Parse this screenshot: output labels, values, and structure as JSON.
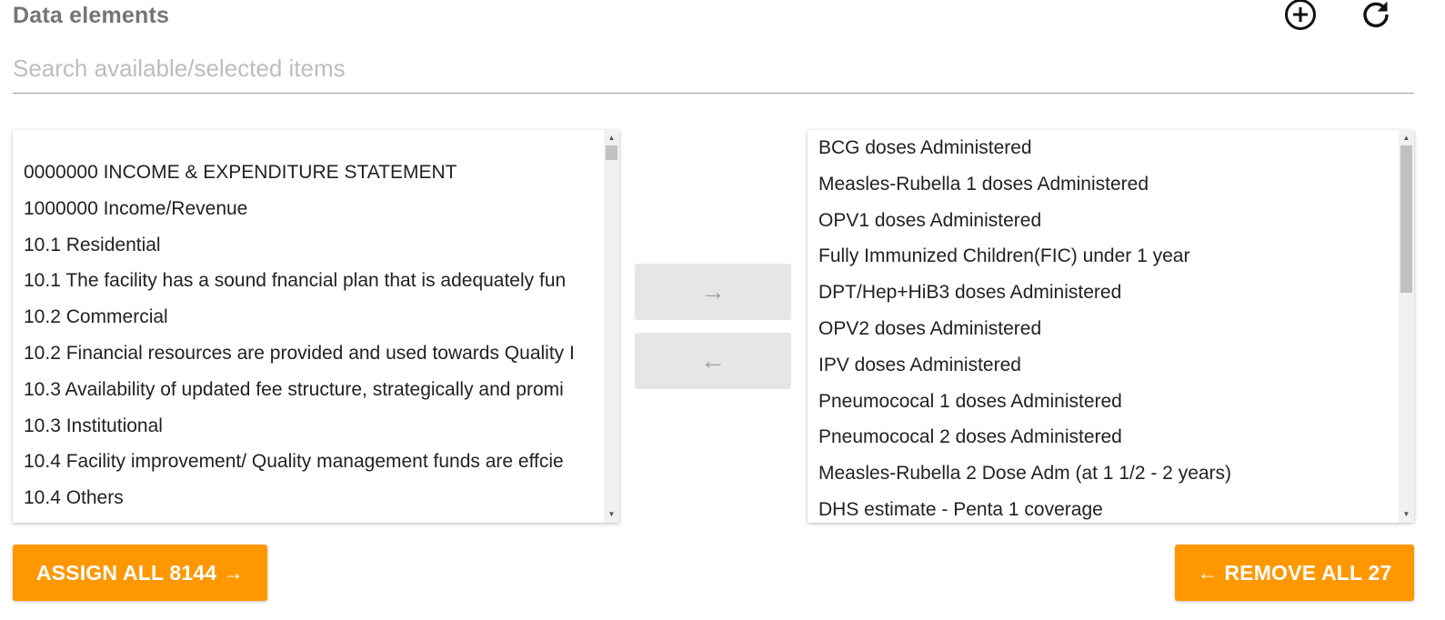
{
  "header": {
    "title": "Data elements",
    "add_icon": "add-circle-icon",
    "refresh_icon": "refresh-icon"
  },
  "search": {
    "placeholder": "Search available/selected items",
    "value": ""
  },
  "available": {
    "items": [
      "0000000 INCOME & EXPENDITURE STATEMENT",
      "1000000 Income/Revenue",
      "10.1 Residential",
      "10.1 The facility has a sound fnancial plan that is adequately fun",
      "10.2 Commercial",
      "10.2 Financial resources are provided and used towards Quality I",
      "10.3 Availability of updated fee structure, strategically and promi",
      "10.3 Institutional",
      "10.4 Facility improvement/ Quality management funds are effcie",
      "10.4 Others"
    ]
  },
  "selected": {
    "items": [
      "BCG doses Administered",
      "Measles-Rubella 1 doses Administered",
      "OPV1 doses Administered",
      "Fully Immunized Children(FIC) under 1 year",
      "DPT/Hep+HiB3 doses Administered",
      "OPV2 doses Administered",
      "IPV doses Administered",
      "Pneumococal 1 doses Administered",
      "Pneumococal 2 doses Administered",
      "Measles-Rubella 2 Dose Adm (at 1 1/2 - 2 years)",
      "DHS estimate - Penta 1 coverage"
    ]
  },
  "controls": {
    "move_right": "→",
    "move_left": "←",
    "assign_all": "ASSIGN ALL 8144 →",
    "remove_all": "← REMOVE ALL 27"
  },
  "colors": {
    "accent": "#ff9800",
    "title_gray": "#757575",
    "disabled_button": "#e6e6e6"
  }
}
